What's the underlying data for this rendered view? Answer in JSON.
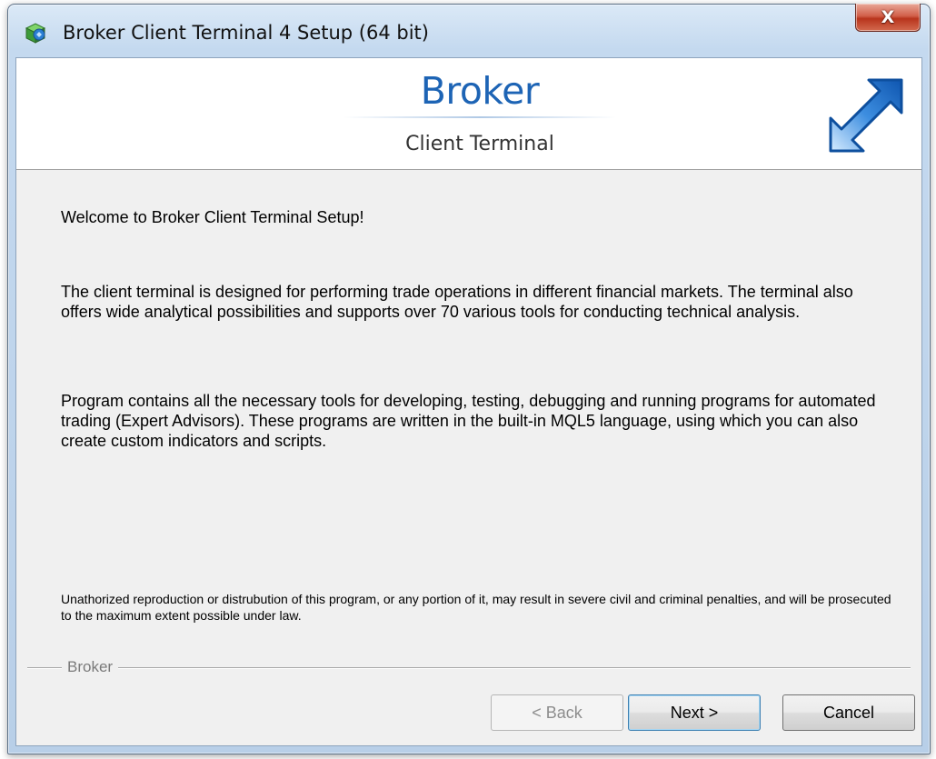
{
  "window": {
    "title": "Broker Client Terminal 4 Setup (64 bit)",
    "close_label": "X",
    "app_icon": "installer-box-icon"
  },
  "banner": {
    "brand_name": "Broker",
    "brand_sub": "Client Terminal",
    "logo_icon": "double-arrow-icon",
    "colors": {
      "brand": "#1d64b5",
      "arrow": "#1e6fd0"
    }
  },
  "content": {
    "welcome": "Welcome to Broker Client Terminal  Setup!",
    "paragraph1": "The client terminal is designed for performing trade operations in different financial markets. The terminal also offers wide analytical possibilities and supports over 70 various tools for conducting technical analysis.",
    "paragraph2": "Program contains all the necessary tools for developing, testing, debugging and running programs for automated trading (Expert Advisors). These programs are written in the built-in MQL5 language, using which you can also create custom indicators and scripts.",
    "legal": "Unathorized reproduction or distrubution of this program, or any portion of it, may result in severe civil and criminal penalties, and will be prosecuted to the maximum extent possible under law."
  },
  "footer": {
    "group_label": "Broker",
    "back_label": "< Back",
    "next_label": "Next >",
    "cancel_label": "Cancel",
    "back_enabled": false
  }
}
